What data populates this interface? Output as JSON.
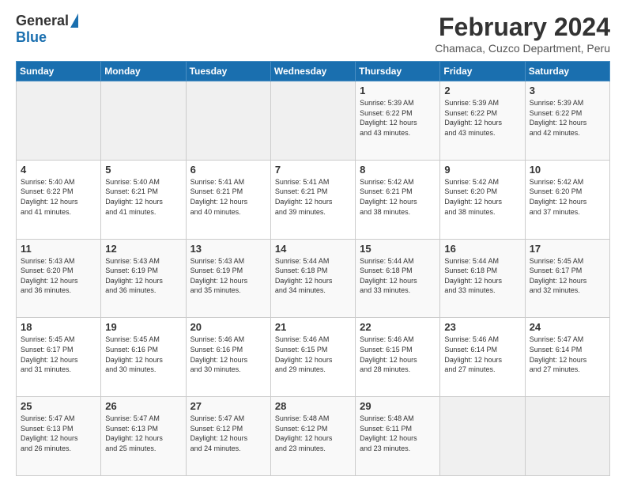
{
  "header": {
    "logo_general": "General",
    "logo_blue": "Blue",
    "title": "February 2024",
    "subtitle": "Chamaca, Cuzco Department, Peru"
  },
  "calendar": {
    "days_of_week": [
      "Sunday",
      "Monday",
      "Tuesday",
      "Wednesday",
      "Thursday",
      "Friday",
      "Saturday"
    ],
    "weeks": [
      [
        {
          "day": "",
          "info": ""
        },
        {
          "day": "",
          "info": ""
        },
        {
          "day": "",
          "info": ""
        },
        {
          "day": "",
          "info": ""
        },
        {
          "day": "1",
          "info": "Sunrise: 5:39 AM\nSunset: 6:22 PM\nDaylight: 12 hours\nand 43 minutes."
        },
        {
          "day": "2",
          "info": "Sunrise: 5:39 AM\nSunset: 6:22 PM\nDaylight: 12 hours\nand 43 minutes."
        },
        {
          "day": "3",
          "info": "Sunrise: 5:39 AM\nSunset: 6:22 PM\nDaylight: 12 hours\nand 42 minutes."
        }
      ],
      [
        {
          "day": "4",
          "info": "Sunrise: 5:40 AM\nSunset: 6:22 PM\nDaylight: 12 hours\nand 41 minutes."
        },
        {
          "day": "5",
          "info": "Sunrise: 5:40 AM\nSunset: 6:21 PM\nDaylight: 12 hours\nand 41 minutes."
        },
        {
          "day": "6",
          "info": "Sunrise: 5:41 AM\nSunset: 6:21 PM\nDaylight: 12 hours\nand 40 minutes."
        },
        {
          "day": "7",
          "info": "Sunrise: 5:41 AM\nSunset: 6:21 PM\nDaylight: 12 hours\nand 39 minutes."
        },
        {
          "day": "8",
          "info": "Sunrise: 5:42 AM\nSunset: 6:21 PM\nDaylight: 12 hours\nand 38 minutes."
        },
        {
          "day": "9",
          "info": "Sunrise: 5:42 AM\nSunset: 6:20 PM\nDaylight: 12 hours\nand 38 minutes."
        },
        {
          "day": "10",
          "info": "Sunrise: 5:42 AM\nSunset: 6:20 PM\nDaylight: 12 hours\nand 37 minutes."
        }
      ],
      [
        {
          "day": "11",
          "info": "Sunrise: 5:43 AM\nSunset: 6:20 PM\nDaylight: 12 hours\nand 36 minutes."
        },
        {
          "day": "12",
          "info": "Sunrise: 5:43 AM\nSunset: 6:19 PM\nDaylight: 12 hours\nand 36 minutes."
        },
        {
          "day": "13",
          "info": "Sunrise: 5:43 AM\nSunset: 6:19 PM\nDaylight: 12 hours\nand 35 minutes."
        },
        {
          "day": "14",
          "info": "Sunrise: 5:44 AM\nSunset: 6:18 PM\nDaylight: 12 hours\nand 34 minutes."
        },
        {
          "day": "15",
          "info": "Sunrise: 5:44 AM\nSunset: 6:18 PM\nDaylight: 12 hours\nand 33 minutes."
        },
        {
          "day": "16",
          "info": "Sunrise: 5:44 AM\nSunset: 6:18 PM\nDaylight: 12 hours\nand 33 minutes."
        },
        {
          "day": "17",
          "info": "Sunrise: 5:45 AM\nSunset: 6:17 PM\nDaylight: 12 hours\nand 32 minutes."
        }
      ],
      [
        {
          "day": "18",
          "info": "Sunrise: 5:45 AM\nSunset: 6:17 PM\nDaylight: 12 hours\nand 31 minutes."
        },
        {
          "day": "19",
          "info": "Sunrise: 5:45 AM\nSunset: 6:16 PM\nDaylight: 12 hours\nand 30 minutes."
        },
        {
          "day": "20",
          "info": "Sunrise: 5:46 AM\nSunset: 6:16 PM\nDaylight: 12 hours\nand 30 minutes."
        },
        {
          "day": "21",
          "info": "Sunrise: 5:46 AM\nSunset: 6:15 PM\nDaylight: 12 hours\nand 29 minutes."
        },
        {
          "day": "22",
          "info": "Sunrise: 5:46 AM\nSunset: 6:15 PM\nDaylight: 12 hours\nand 28 minutes."
        },
        {
          "day": "23",
          "info": "Sunrise: 5:46 AM\nSunset: 6:14 PM\nDaylight: 12 hours\nand 27 minutes."
        },
        {
          "day": "24",
          "info": "Sunrise: 5:47 AM\nSunset: 6:14 PM\nDaylight: 12 hours\nand 27 minutes."
        }
      ],
      [
        {
          "day": "25",
          "info": "Sunrise: 5:47 AM\nSunset: 6:13 PM\nDaylight: 12 hours\nand 26 minutes."
        },
        {
          "day": "26",
          "info": "Sunrise: 5:47 AM\nSunset: 6:13 PM\nDaylight: 12 hours\nand 25 minutes."
        },
        {
          "day": "27",
          "info": "Sunrise: 5:47 AM\nSunset: 6:12 PM\nDaylight: 12 hours\nand 24 minutes."
        },
        {
          "day": "28",
          "info": "Sunrise: 5:48 AM\nSunset: 6:12 PM\nDaylight: 12 hours\nand 23 minutes."
        },
        {
          "day": "29",
          "info": "Sunrise: 5:48 AM\nSunset: 6:11 PM\nDaylight: 12 hours\nand 23 minutes."
        },
        {
          "day": "",
          "info": ""
        },
        {
          "day": "",
          "info": ""
        }
      ]
    ]
  }
}
